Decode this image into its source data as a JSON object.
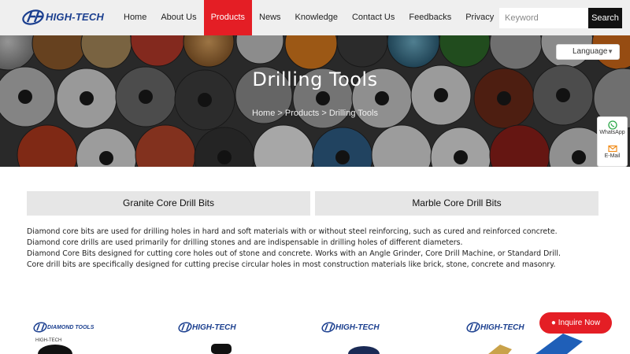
{
  "header": {
    "logo_text": "HIGH-TECH",
    "nav": [
      {
        "label": "Home"
      },
      {
        "label": "About Us"
      },
      {
        "label": "Products",
        "active": true
      },
      {
        "label": "News"
      },
      {
        "label": "Knowledge"
      },
      {
        "label": "Contact Us"
      },
      {
        "label": "Feedbacks"
      },
      {
        "label": "Privacy"
      }
    ],
    "search": {
      "placeholder": "Keyword",
      "value": "",
      "button_label": "Search"
    }
  },
  "banner": {
    "title": "Drilling Tools",
    "breadcrumb": "Home > Products > Drilling Tools",
    "language_label": "Language",
    "language_icon": "chevron-down-icon"
  },
  "float_contact": {
    "whatsapp_label": "WhatsApp",
    "email_label": "E-Mail"
  },
  "categories": [
    {
      "label": "Granite Core Drill Bits"
    },
    {
      "label": "Marble Core Drill Bits"
    }
  ],
  "description": [
    "Diamond core bits are used for drilling holes in hard and soft materials with or without steel reinforcing, such as cured and reinforced concrete.",
    "Diamond core drills are used primarily for drilling stones and are indispensable in drilling holes of different diameters.",
    "Diamond Core Bits designed for cutting core holes out of stone and concrete. Works with an Angle Grinder, Core Drill Machine, or Standard Drill.",
    "Core drill bits are specifically designed for cutting precise circular holes in most construction materials like brick, stone, concrete and masonry."
  ],
  "products": [
    {
      "logo_text": "DIAMOND TOOLS",
      "sub_text": "HIGH-TECH"
    },
    {
      "logo_text": "HIGH-TECH"
    },
    {
      "logo_text": "HIGH-TECH"
    },
    {
      "logo_text": "HIGH-TECH"
    }
  ],
  "inquire_label": "Inquire Now",
  "colors": {
    "accent": "#e41e25",
    "brand_blue": "#1b3f8f",
    "header_bg": "#efefef",
    "category_bg": "#e6e6e6"
  }
}
